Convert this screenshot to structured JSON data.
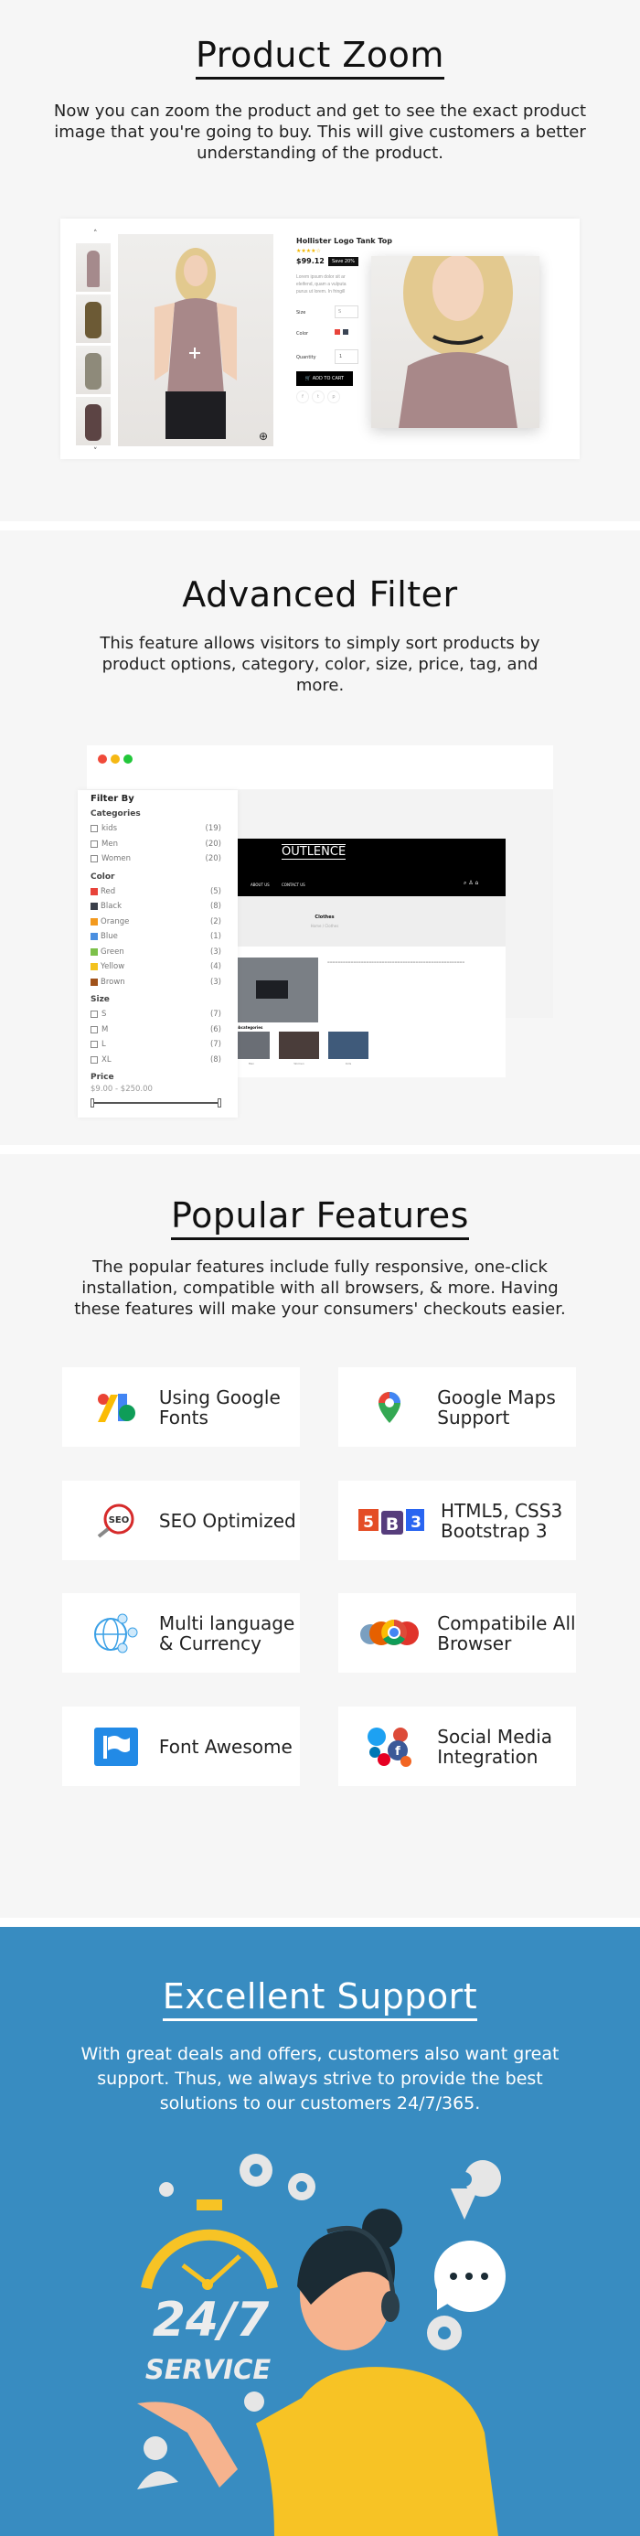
{
  "product_zoom": {
    "title": "Product Zoom",
    "description": "Now you can zoom the product and get to see the exact product image that you're going to buy. This will give customers a better understanding of the product.",
    "product": {
      "name": "Hollister Logo Tank Top",
      "rating": 4,
      "price": "$99.12",
      "badge": "Save 20%",
      "desc_lines": [
        "Lorem ipsum dolor sit ar",
        "eleifend, quam a vulputa",
        "purus ut lorem. In fringill"
      ],
      "size_label": "Size",
      "size_value": "S",
      "color_label": "Color",
      "colors": [
        "#e8433a",
        "#3a4454"
      ],
      "quantity_label": "Quantity",
      "quantity_value": "1",
      "add_to_cart": "ADD TO CART",
      "social": [
        "f",
        "t",
        "p"
      ]
    }
  },
  "advanced_filter": {
    "title": "Advanced Filter",
    "description": "This feature allows visitors to simply sort products by product options, category, color, size, price, tag, and more.",
    "filter": {
      "heading": "Filter By",
      "categories_label": "Categories",
      "categories": [
        {
          "label": "kids",
          "count": "(19)"
        },
        {
          "label": "Men",
          "count": "(20)"
        },
        {
          "label": "Women",
          "count": "(20)"
        }
      ],
      "color_label": "Color",
      "colors": [
        {
          "label": "Red",
          "count": "(5)",
          "hex": "#e8433a"
        },
        {
          "label": "Black",
          "count": "(8)",
          "hex": "#3a3f4a"
        },
        {
          "label": "Orange",
          "count": "(2)",
          "hex": "#f39a1e"
        },
        {
          "label": "Blue",
          "count": "(1)",
          "hex": "#4a8fe0"
        },
        {
          "label": "Green",
          "count": "(3)",
          "hex": "#7cc04a"
        },
        {
          "label": "Yellow",
          "count": "(4)",
          "hex": "#f3c21e"
        },
        {
          "label": "Brown",
          "count": "(3)",
          "hex": "#a0521a"
        }
      ],
      "size_label": "Size",
      "sizes": [
        {
          "label": "S",
          "count": "(7)"
        },
        {
          "label": "M",
          "count": "(6)"
        },
        {
          "label": "L",
          "count": "(7)"
        },
        {
          "label": "XL",
          "count": "(8)"
        }
      ],
      "price_label": "Price",
      "price_range": "$9.00 - $250.00"
    },
    "store": {
      "logo": "OUTLENCE",
      "nav": [
        "ABOUT US",
        "CONTACT US"
      ],
      "page_title": "Clothes",
      "breadcrumb": "Home / Clothes",
      "subcategories_label": "Subcategories",
      "subcategories": [
        "Men",
        "Women",
        "Kids"
      ]
    }
  },
  "popular_features": {
    "title": "Popular Features",
    "description": "The popular features include  fully responsive, one-click installation, compatible with all browsers, & more. Having these features will make your consumers' checkouts easier.",
    "items": [
      {
        "label": "Using Google Fonts",
        "icon": "google-fonts-icon"
      },
      {
        "label": "Google Maps Support",
        "icon": "google-maps-icon"
      },
      {
        "label": "SEO Optimized",
        "icon": "seo-icon"
      },
      {
        "label": "HTML5, CSS3 Bootstrap 3",
        "icon": "html5-bootstrap-css3-icon"
      },
      {
        "label": "Multi language & Currency",
        "icon": "globe-currency-icon"
      },
      {
        "label": "Compatibile All Browser",
        "icon": "browsers-icon"
      },
      {
        "label": "Font Awesome",
        "icon": "font-awesome-flag-icon"
      },
      {
        "label": "Social Media Integration",
        "icon": "social-media-icon"
      }
    ]
  },
  "support": {
    "title": "Excellent Support",
    "description": "With great deals and offers, customers also want great support. Thus, we always strive to provide the best solutions to our customers 24/7/365.",
    "badge_big": "24/7",
    "badge_small": "SERVICE",
    "background": "#388cc1"
  }
}
